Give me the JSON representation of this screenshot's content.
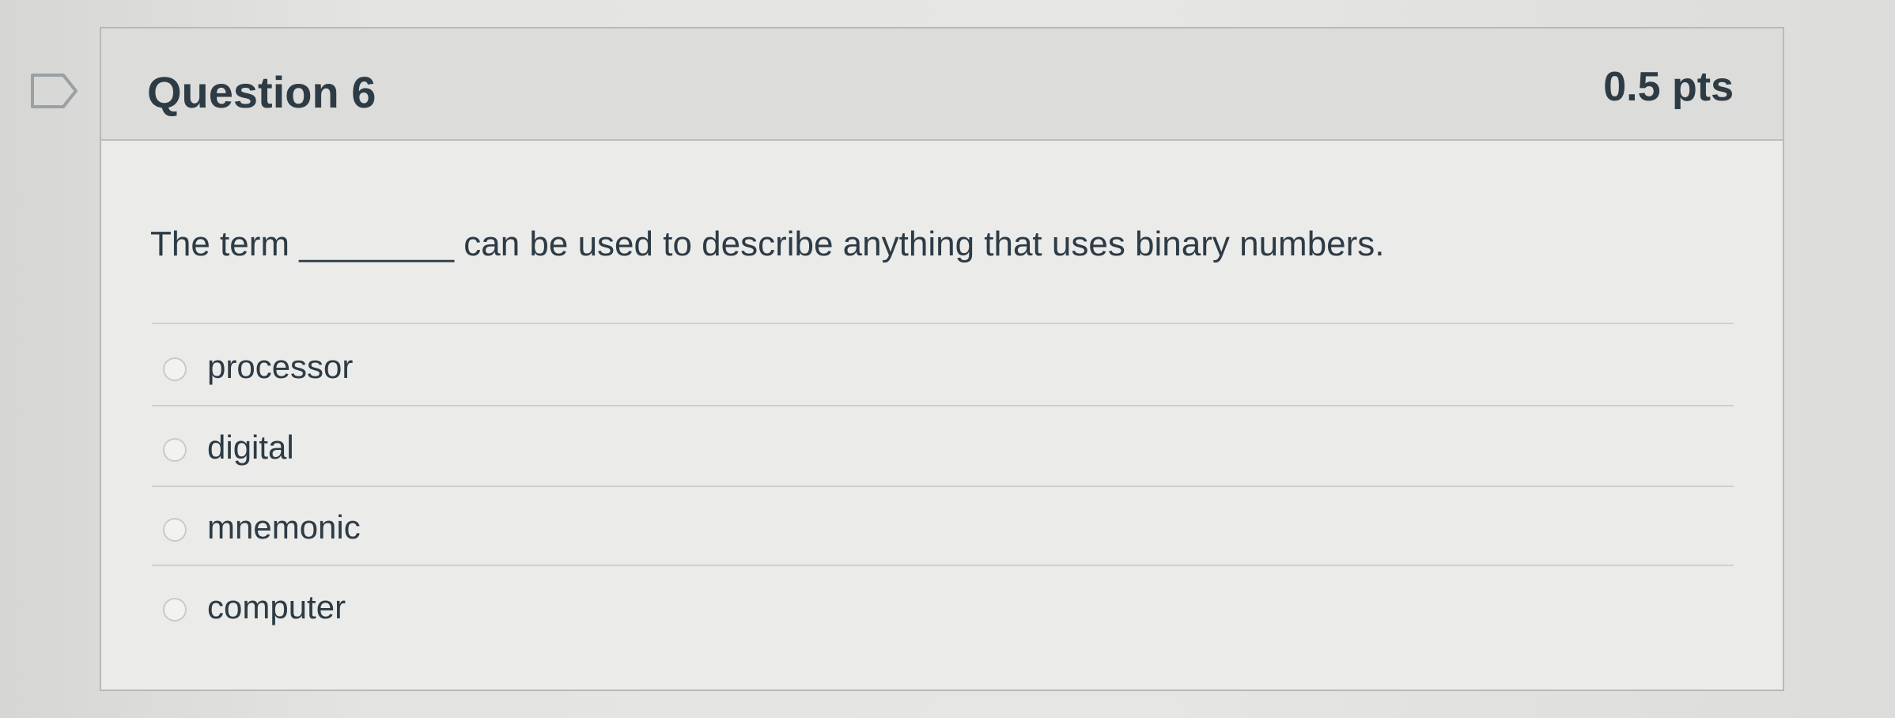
{
  "question": {
    "title": "Question 6",
    "points": "0.5 pts",
    "text": "The term ________ can be used to describe anything that uses binary numbers."
  },
  "flag_icon": "bookmark-flag-icon",
  "answers": [
    {
      "label": "processor",
      "selected": false
    },
    {
      "label": "digital",
      "selected": false
    },
    {
      "label": "mnemonic",
      "selected": false
    },
    {
      "label": "computer",
      "selected": false
    }
  ]
}
